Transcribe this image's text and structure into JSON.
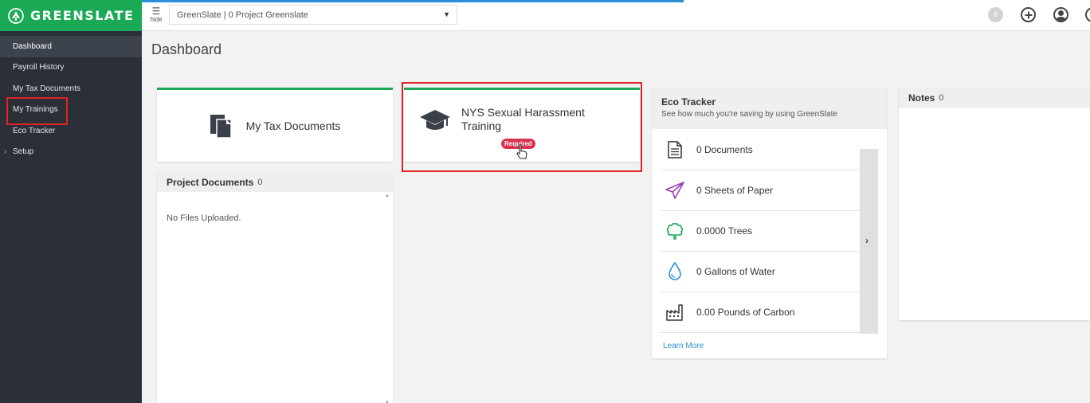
{
  "brand": {
    "name": "GREENSLATE"
  },
  "sidebar": {
    "items": [
      {
        "label": "Dashboard"
      },
      {
        "label": "Payroll History"
      },
      {
        "label": "My Tax Documents"
      },
      {
        "label": "My Trainings"
      },
      {
        "label": "Eco Tracker"
      },
      {
        "label": "Setup"
      }
    ]
  },
  "topbar": {
    "hide_label": "hide",
    "project_select": "GreenSlate | 0 Project Greenslate",
    "notification_count": "0"
  },
  "page": {
    "title": "Dashboard"
  },
  "tax_card": {
    "label": "My Tax Documents"
  },
  "training_card": {
    "title": "NYS Sexual Harassment Training",
    "badge": "Required"
  },
  "project_documents": {
    "title": "Project Documents",
    "count": "0",
    "empty": "No Files Uploaded."
  },
  "eco_tracker": {
    "title": "Eco Tracker",
    "subtitle": "See how much you're saving by using GreenSlate",
    "rows": [
      {
        "text": "0 Documents",
        "icon": "document-icon"
      },
      {
        "text": "0 Sheets of Paper",
        "icon": "paper-plane-icon"
      },
      {
        "text": "0.0000 Trees",
        "icon": "tree-icon"
      },
      {
        "text": "0 Gallons of Water",
        "icon": "water-drop-icon"
      },
      {
        "text": "0.00 Pounds of Carbon",
        "icon": "factory-icon"
      }
    ],
    "learn_more": "Learn More"
  },
  "notes": {
    "title": "Notes",
    "count": "0"
  },
  "colors": {
    "brand_green": "#1aaa55",
    "sidebar": "#2b3038",
    "required": "#d9334f",
    "highlight": "#e02424",
    "link": "#2a8fd6"
  }
}
